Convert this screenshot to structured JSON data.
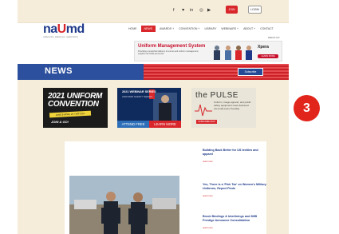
{
  "header": {
    "social_icons": [
      "facebook-icon",
      "twitter-icon",
      "linkedin-icon",
      "instagram-icon",
      "youtube-icon"
    ],
    "social_glyphs": [
      "f",
      "♥",
      "in",
      "◎",
      "▶"
    ],
    "join_label": "JOIN",
    "login_label": "LOGIN"
  },
  "logo": {
    "part1": "na",
    "part2": "U",
    "part3": "md",
    "tagline": "unified voice • industry ties • network forum"
  },
  "nav": {
    "items": [
      "HOME",
      "NEWS",
      "AWARDS +",
      "CONVENTION +",
      "LIBRARY",
      "WEBINARS +",
      "ABOUT +",
      "CONTACT"
    ],
    "active_index": 1,
    "media_kit": "MEDIA KIT"
  },
  "ad": {
    "title": "Uniform Management System",
    "subtitle": "Providing unmatched delivery of end-to-end uniform management, supplies and field personnel.",
    "brand": "Xpera",
    "cta": "LEARN MORE"
  },
  "news_band": {
    "title": "NEWS",
    "subscribe": "Subscribe"
  },
  "cards": {
    "convention": {
      "title_line1": "2021 UNIFORM",
      "title_line2": "CONVENTION",
      "date": "JUNE 8-APRIL 24 • VIRTUAL",
      "foot": "JOIN & GO!"
    },
    "webinar": {
      "top": "2021 WEBINAR SERIES",
      "sub": "UNIFORM SAFETY SERIES",
      "attend": "ATTEND FREE",
      "learn": "LEARN MORE"
    },
    "pulse": {
      "title": "the PULSE",
      "desc": "Uniform, image apparel, and public safety equipment news delivered via email every Tuesday",
      "cta": "SUBSCRIBE NOW"
    }
  },
  "badge": {
    "number": "3"
  },
  "articles": [
    {
      "title": "Building Back Better for US textiles and apparel",
      "more": "read more"
    },
    {
      "title": "Yes, There is a 'Pink Tax' on Women's Military Uniforms, Report Finds",
      "more": "read more"
    },
    {
      "title": "Brock Bindings & Interlinings and M3B Prestige Announce Consolidation",
      "more": "read more"
    }
  ],
  "colors": {
    "brand_blue": "#1f3a8a",
    "brand_red": "#d8262b",
    "cream": "#f5ecd9"
  }
}
